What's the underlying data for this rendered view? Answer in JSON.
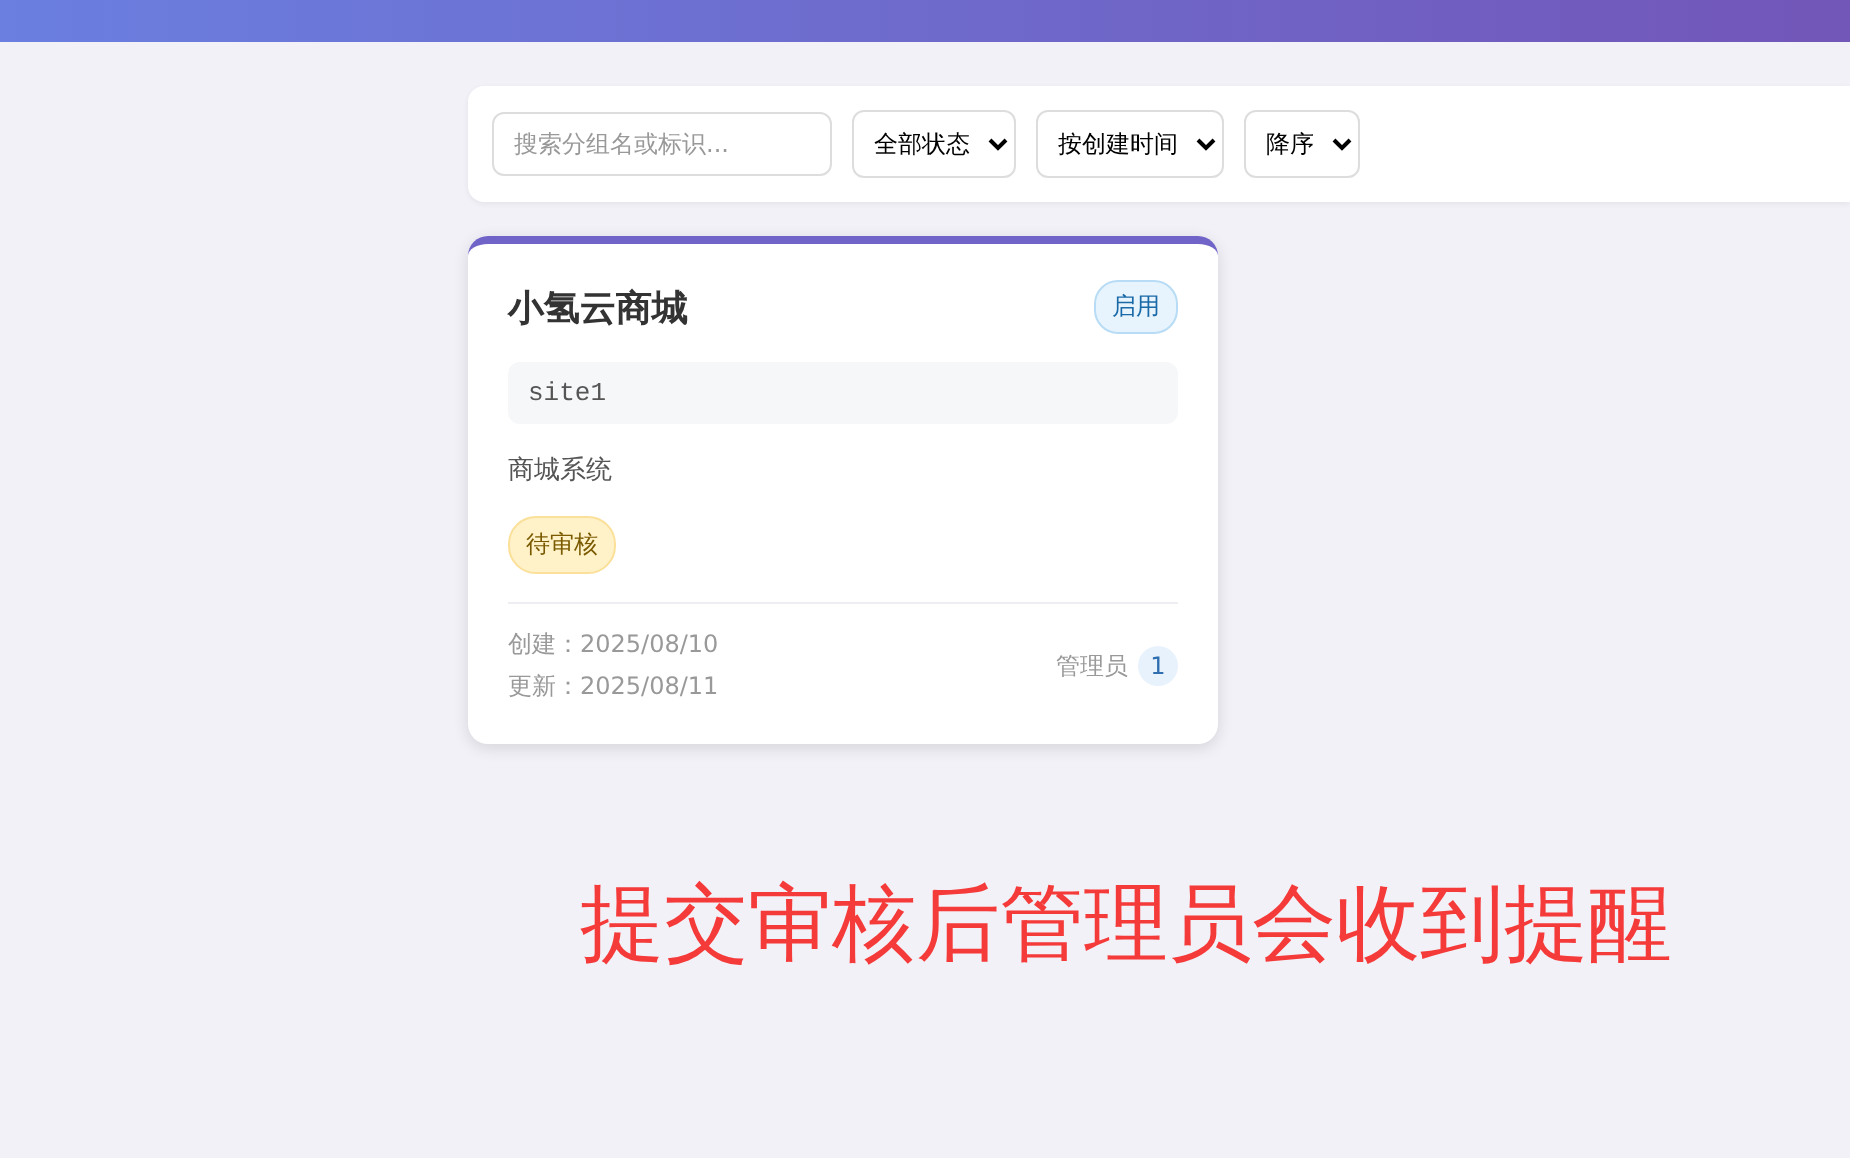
{
  "filters": {
    "search": {
      "placeholder": "搜索分组名或标识..."
    },
    "selects": [
      {
        "value": "全部状态"
      },
      {
        "value": "按创建时间"
      },
      {
        "value": "降序"
      }
    ]
  },
  "cards": [
    {
      "title": "小氢云商城",
      "status": {
        "label": "启用",
        "kind": "enabled"
      },
      "code": "site1",
      "description": "商城系统",
      "review": {
        "label": "待审核",
        "kind": "pending"
      },
      "created": "创建：2025/08/10",
      "updated": "更新：2025/08/11",
      "admin_label": "管理员",
      "admin_count": "1"
    }
  ],
  "annotation": "提交审核后管理员会收到提醒"
}
